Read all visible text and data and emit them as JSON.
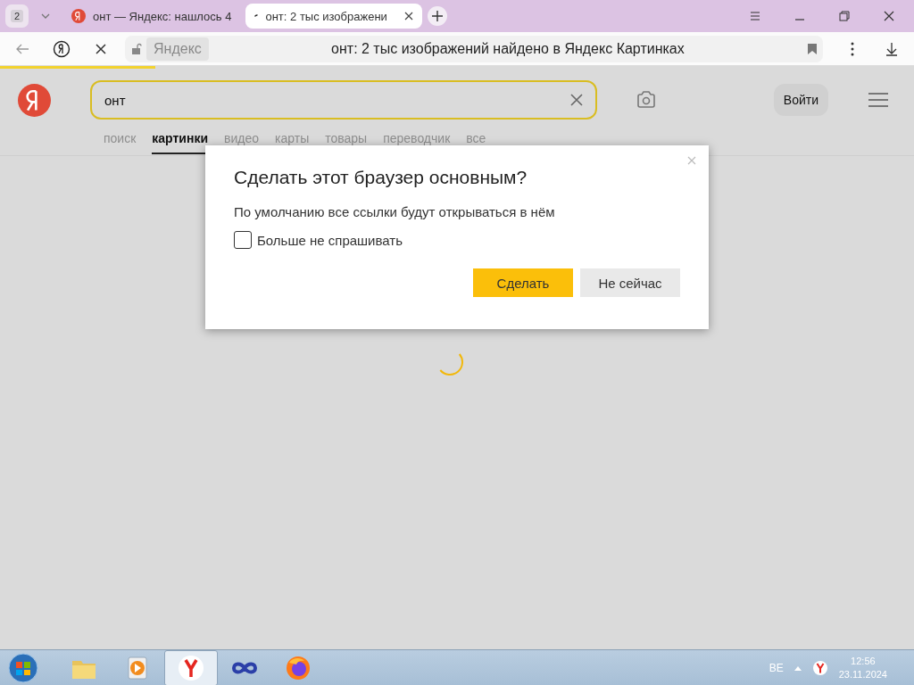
{
  "browser": {
    "tab_count": "2",
    "tabs": [
      {
        "title": "онт — Яндекс: нашлось 4",
        "selected": false,
        "loading": false
      },
      {
        "title": "онт: 2 тыс изображени",
        "selected": true,
        "loading": true
      }
    ],
    "address": {
      "site": "Яндекс",
      "title": "онт: 2 тыс изображений найдено в Яндекс Картинках"
    },
    "page_load": {
      "level": 0.17
    }
  },
  "page": {
    "search": {
      "value": "онт"
    },
    "login": "Войти",
    "nav": [
      {
        "label": "поиск",
        "selected": false
      },
      {
        "label": "картинки",
        "selected": true
      },
      {
        "label": "видео",
        "selected": false
      },
      {
        "label": "карты",
        "selected": false
      },
      {
        "label": "товары",
        "selected": false
      },
      {
        "label": "переводчик",
        "selected": false
      },
      {
        "label": "все",
        "selected": false
      }
    ]
  },
  "dialog": {
    "title": "Сделать этот браузер основным?",
    "text": "По умолчанию все ссылки будут открываться в нём",
    "checkbox": {
      "label": "Больше не спрашивать",
      "checked": false
    },
    "buttons": [
      {
        "label": "Сделать",
        "kind": "primary"
      },
      {
        "label": "Не сейчас",
        "kind": "secondary"
      }
    ]
  },
  "taskbar": {
    "apps": [
      {
        "kind": "folder",
        "selected": false
      },
      {
        "kind": "player",
        "selected": false
      },
      {
        "kind": "yandex",
        "selected": true
      },
      {
        "kind": "infinity",
        "selected": false
      },
      {
        "kind": "firefox",
        "selected": false
      }
    ],
    "language": "BE",
    "time": "12:56",
    "date": "23.11.2024"
  }
}
